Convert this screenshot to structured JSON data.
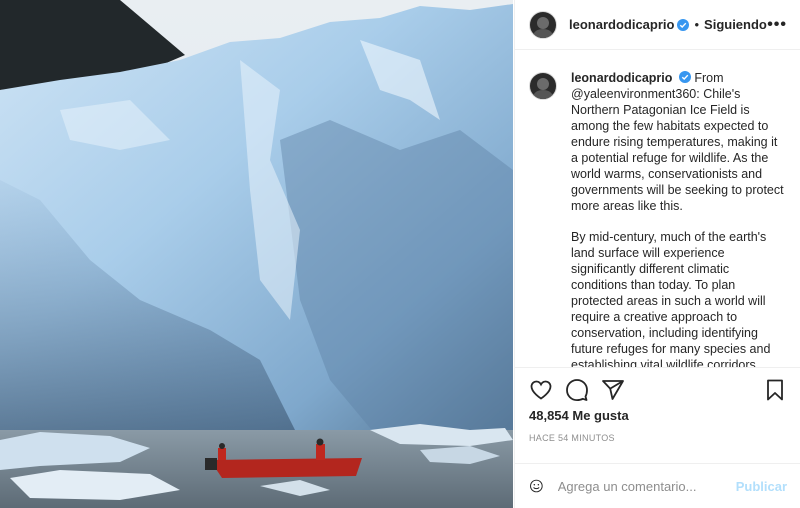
{
  "post": {
    "username": "leonardodicaprio",
    "follow_status": "Siguiendo",
    "dot": "•",
    "more": "•••",
    "photo_alt": "Glaciar con bote rojo"
  },
  "caption": {
    "username": "leonardodicaprio",
    "paragraph1": "From @yaleenvironment360: Chile's Northern Patagonian Ice Field is among the few habitats expected to endure rising temperatures, making it a potential refuge for wildlife. As the world warms, conservationists and governments will be seeking to protect more areas like this.",
    "paragraph2": "By mid-century, much of the earth's land surface will experience significantly different climatic conditions than today. To plan protected areas in such a world will require a creative approach to conservation, including identifying future refuges for many species and establishing vital wildlife corridors."
  },
  "stats": {
    "likes": "48,854 Me gusta",
    "time": "HACE 54 MINUTOS"
  },
  "comment_box": {
    "placeholder": "Agrega un comentario...",
    "publish_label": "Publicar"
  },
  "icons": {
    "verified": "verified-badge-icon",
    "like": "heart-icon",
    "comment": "comment-icon",
    "share": "paper-plane-icon",
    "save": "bookmark-icon",
    "emoji": "smiley-icon"
  },
  "colors": {
    "verified": "#3897f0",
    "publish_disabled": "#b2dffc",
    "text": "#262626",
    "muted": "#8e8e8e"
  }
}
